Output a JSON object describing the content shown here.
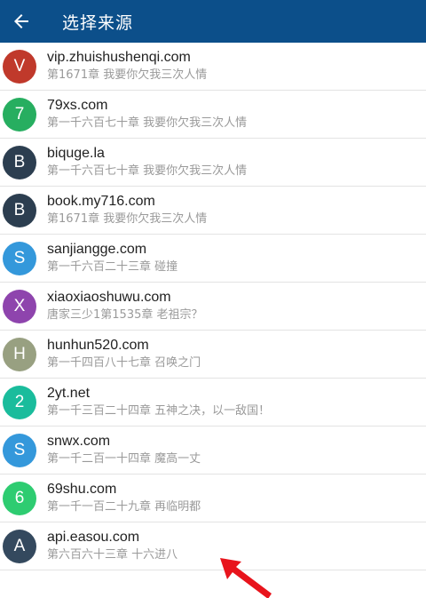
{
  "header": {
    "title": "选择来源",
    "background": "#0c4f8a"
  },
  "sources": [
    {
      "letter": "V",
      "name": "vip.zhuishushenqi.com",
      "chapter": "第1671章 我要你欠我三次人情",
      "color": "#c0392b"
    },
    {
      "letter": "7",
      "name": "79xs.com",
      "chapter": "第一千六百七十章 我要你欠我三次人情",
      "color": "#27ae60"
    },
    {
      "letter": "B",
      "name": "biquge.la",
      "chapter": "第一千六百七十章 我要你欠我三次人情",
      "color": "#2c3e50"
    },
    {
      "letter": "B",
      "name": "book.my716.com",
      "chapter": "第1671章 我要你欠我三次人情",
      "color": "#2c3e50"
    },
    {
      "letter": "S",
      "name": "sanjiangge.com",
      "chapter": "第一千六百二十三章 碰撞",
      "color": "#3498db"
    },
    {
      "letter": "X",
      "name": "xiaoxiaoshuwu.com",
      "chapter": "唐家三少1第1535章 老祖宗？",
      "color": "#8e44ad"
    },
    {
      "letter": "H",
      "name": "hunhun520.com",
      "chapter": "第一千四百八十七章 召唤之门",
      "color": "#98a081"
    },
    {
      "letter": "2",
      "name": "2yt.net",
      "chapter": "第一千三百二十四章 五神之决，以一敌国！",
      "color": "#1abc9c"
    },
    {
      "letter": "S",
      "name": "snwx.com",
      "chapter": "第一千二百一十四章 魔高一丈",
      "color": "#3498db"
    },
    {
      "letter": "6",
      "name": "69shu.com",
      "chapter": "第一千一百二十九章 再临明都",
      "color": "#2ecc71"
    },
    {
      "letter": "A",
      "name": "api.easou.com",
      "chapter": "第六百六十三章 十六进八",
      "color": "#34495e"
    }
  ],
  "annotation_color": "#e8141c"
}
